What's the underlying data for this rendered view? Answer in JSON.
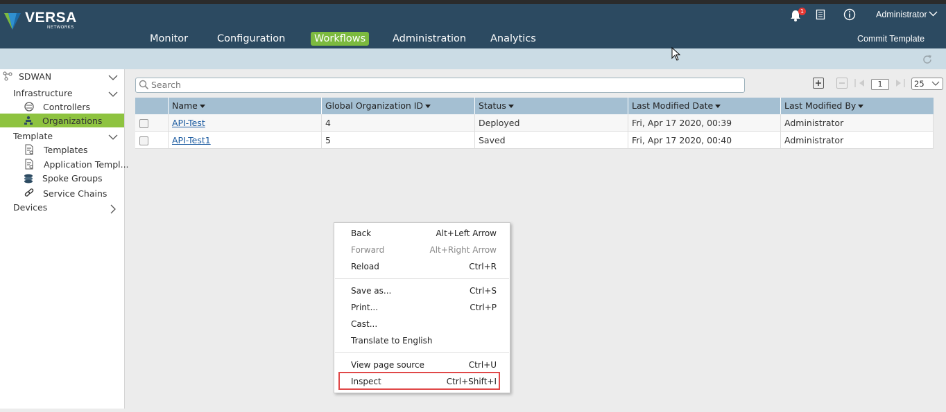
{
  "header": {
    "logo_text": "VERSA",
    "logo_sub": "NETWORKS",
    "nav": [
      "Monitor",
      "Configuration",
      "Workflows",
      "Administration",
      "Analytics"
    ],
    "active_nav": "Workflows",
    "notification_count": "1",
    "user": "Administrator",
    "commit_label": "Commit Template",
    "accent_color": "#7cba3f",
    "bar_color": "#2c4a61"
  },
  "sidebar": {
    "root": "SDWAN",
    "infrastructure": "Infrastructure",
    "controllers": "Controllers",
    "organizations": "Organizations",
    "template": "Template",
    "templates": "Templates",
    "application_templates": "Application Templ...",
    "spoke_groups": "Spoke Groups",
    "service_chains": "Service Chains",
    "devices": "Devices",
    "selected_color": "#8ec340"
  },
  "search": {
    "placeholder": "Search"
  },
  "pagination": {
    "page": "1",
    "page_size": "25"
  },
  "table": {
    "columns": [
      "Name",
      "Global Organization ID",
      "Status",
      "Last Modified Date",
      "Last Modified By"
    ],
    "rows": [
      {
        "name": "API-Test",
        "id": "4",
        "status": "Deployed",
        "date": "Fri, Apr 17 2020, 00:39",
        "by": "Administrator"
      },
      {
        "name": "API-Test1",
        "id": "5",
        "status": "Saved",
        "date": "Fri, Apr 17 2020, 00:40",
        "by": "Administrator"
      }
    ]
  },
  "context_menu": {
    "items": [
      {
        "label": "Back",
        "shortcut": "Alt+Left Arrow"
      },
      {
        "label": "Forward",
        "shortcut": "Alt+Right Arrow"
      },
      {
        "label": "Reload",
        "shortcut": "Ctrl+R"
      },
      {
        "label": "Save as...",
        "shortcut": "Ctrl+S"
      },
      {
        "label": "Print...",
        "shortcut": "Ctrl+P"
      },
      {
        "label": "Cast...",
        "shortcut": ""
      },
      {
        "label": "Translate to English",
        "shortcut": ""
      },
      {
        "label": "View page source",
        "shortcut": "Ctrl+U"
      },
      {
        "label": "Inspect",
        "shortcut": "Ctrl+Shift+I"
      }
    ],
    "highlight_color": "#e04848"
  }
}
